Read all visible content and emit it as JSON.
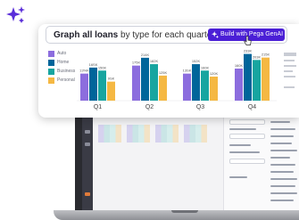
{
  "prompt": {
    "bold": "Graph all loans",
    "rest": " by type for each quarter",
    "button_label": "Build with Pega GenAI"
  },
  "colors": {
    "auto": "#8c6dde",
    "home": "#00659a",
    "business": "#17a5a0",
    "personal": "#f5b843",
    "button": "#4b1fd6",
    "sparkle": "#5a2ed9"
  },
  "legend": [
    {
      "label": "Auto",
      "color": "#8c6dde"
    },
    {
      "label": "Home",
      "color": "#00659a"
    },
    {
      "label": "Business",
      "color": "#17a5a0"
    },
    {
      "label": "Personal",
      "color": "#f5b843"
    }
  ],
  "chart_data": {
    "type": "bar",
    "categories": [
      "Q1",
      "Q2",
      "Q3",
      "Q4"
    ],
    "series": [
      {
        "name": "Auto",
        "values": [
          135,
          175,
          135,
          160
        ]
      },
      {
        "name": "Home",
        "values": [
          165,
          214,
          182,
          233
        ]
      },
      {
        "name": "Business",
        "values": [
          150,
          182,
          150,
          203
        ]
      },
      {
        "name": "Personal",
        "values": [
          95,
          125,
          120,
          215
        ]
      }
    ],
    "data_labels": [
      [
        "13%K",
        "16SK",
        "150K",
        "9SK"
      ],
      [
        "175K",
        "214K",
        "182K",
        "125K"
      ],
      [
        "13SK",
        "152K",
        "160K",
        "120K"
      ],
      [
        "160K",
        "233K",
        "203K",
        "215K"
      ]
    ],
    "ylim": [
      0,
      240
    ]
  },
  "icons": {
    "sparkle": "sparkle-icon",
    "button_icon": "genai-sparkle-icon",
    "cursor": "hand-pointer-icon"
  }
}
